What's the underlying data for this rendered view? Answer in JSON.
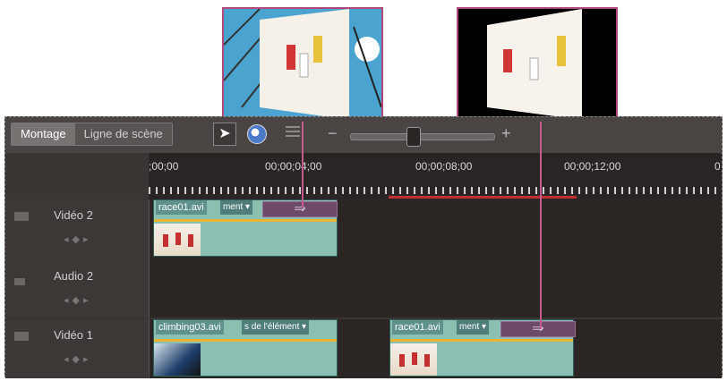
{
  "tabs": [
    {
      "label": "Montage",
      "active": true
    },
    {
      "label": "Ligne de scène",
      "active": false
    }
  ],
  "toolbar": {
    "zoom_minus": "−",
    "zoom_plus": "+",
    "zoom_level": 0.45,
    "icons": [
      "selection-tool-icon",
      "time-stretch-icon",
      "list-icon"
    ]
  },
  "ruler": {
    "labels": [
      ";00;00",
      "00;00;04;00",
      "00;00;08;00",
      "00;00;12;00",
      "0"
    ]
  },
  "tracks": [
    {
      "label": "Vidéo 2",
      "clips": [
        {
          "name": "race01.avi",
          "menu": "ment ▾",
          "transition": "⇒"
        }
      ]
    },
    {
      "label": "Audio 2",
      "clips": []
    },
    {
      "label": "Vidéo 1",
      "clips": [
        {
          "name": "climbing03.avi",
          "menu": "s de l'élément ▾"
        },
        {
          "name": "race01.avi",
          "menu": "ment ▾",
          "transition": "⇒"
        }
      ]
    }
  ],
  "colors": {
    "callout": "#c45b8d",
    "clip": "#8abfb2",
    "transition": "#6d4a6a",
    "audio_line": "#e8b431"
  }
}
